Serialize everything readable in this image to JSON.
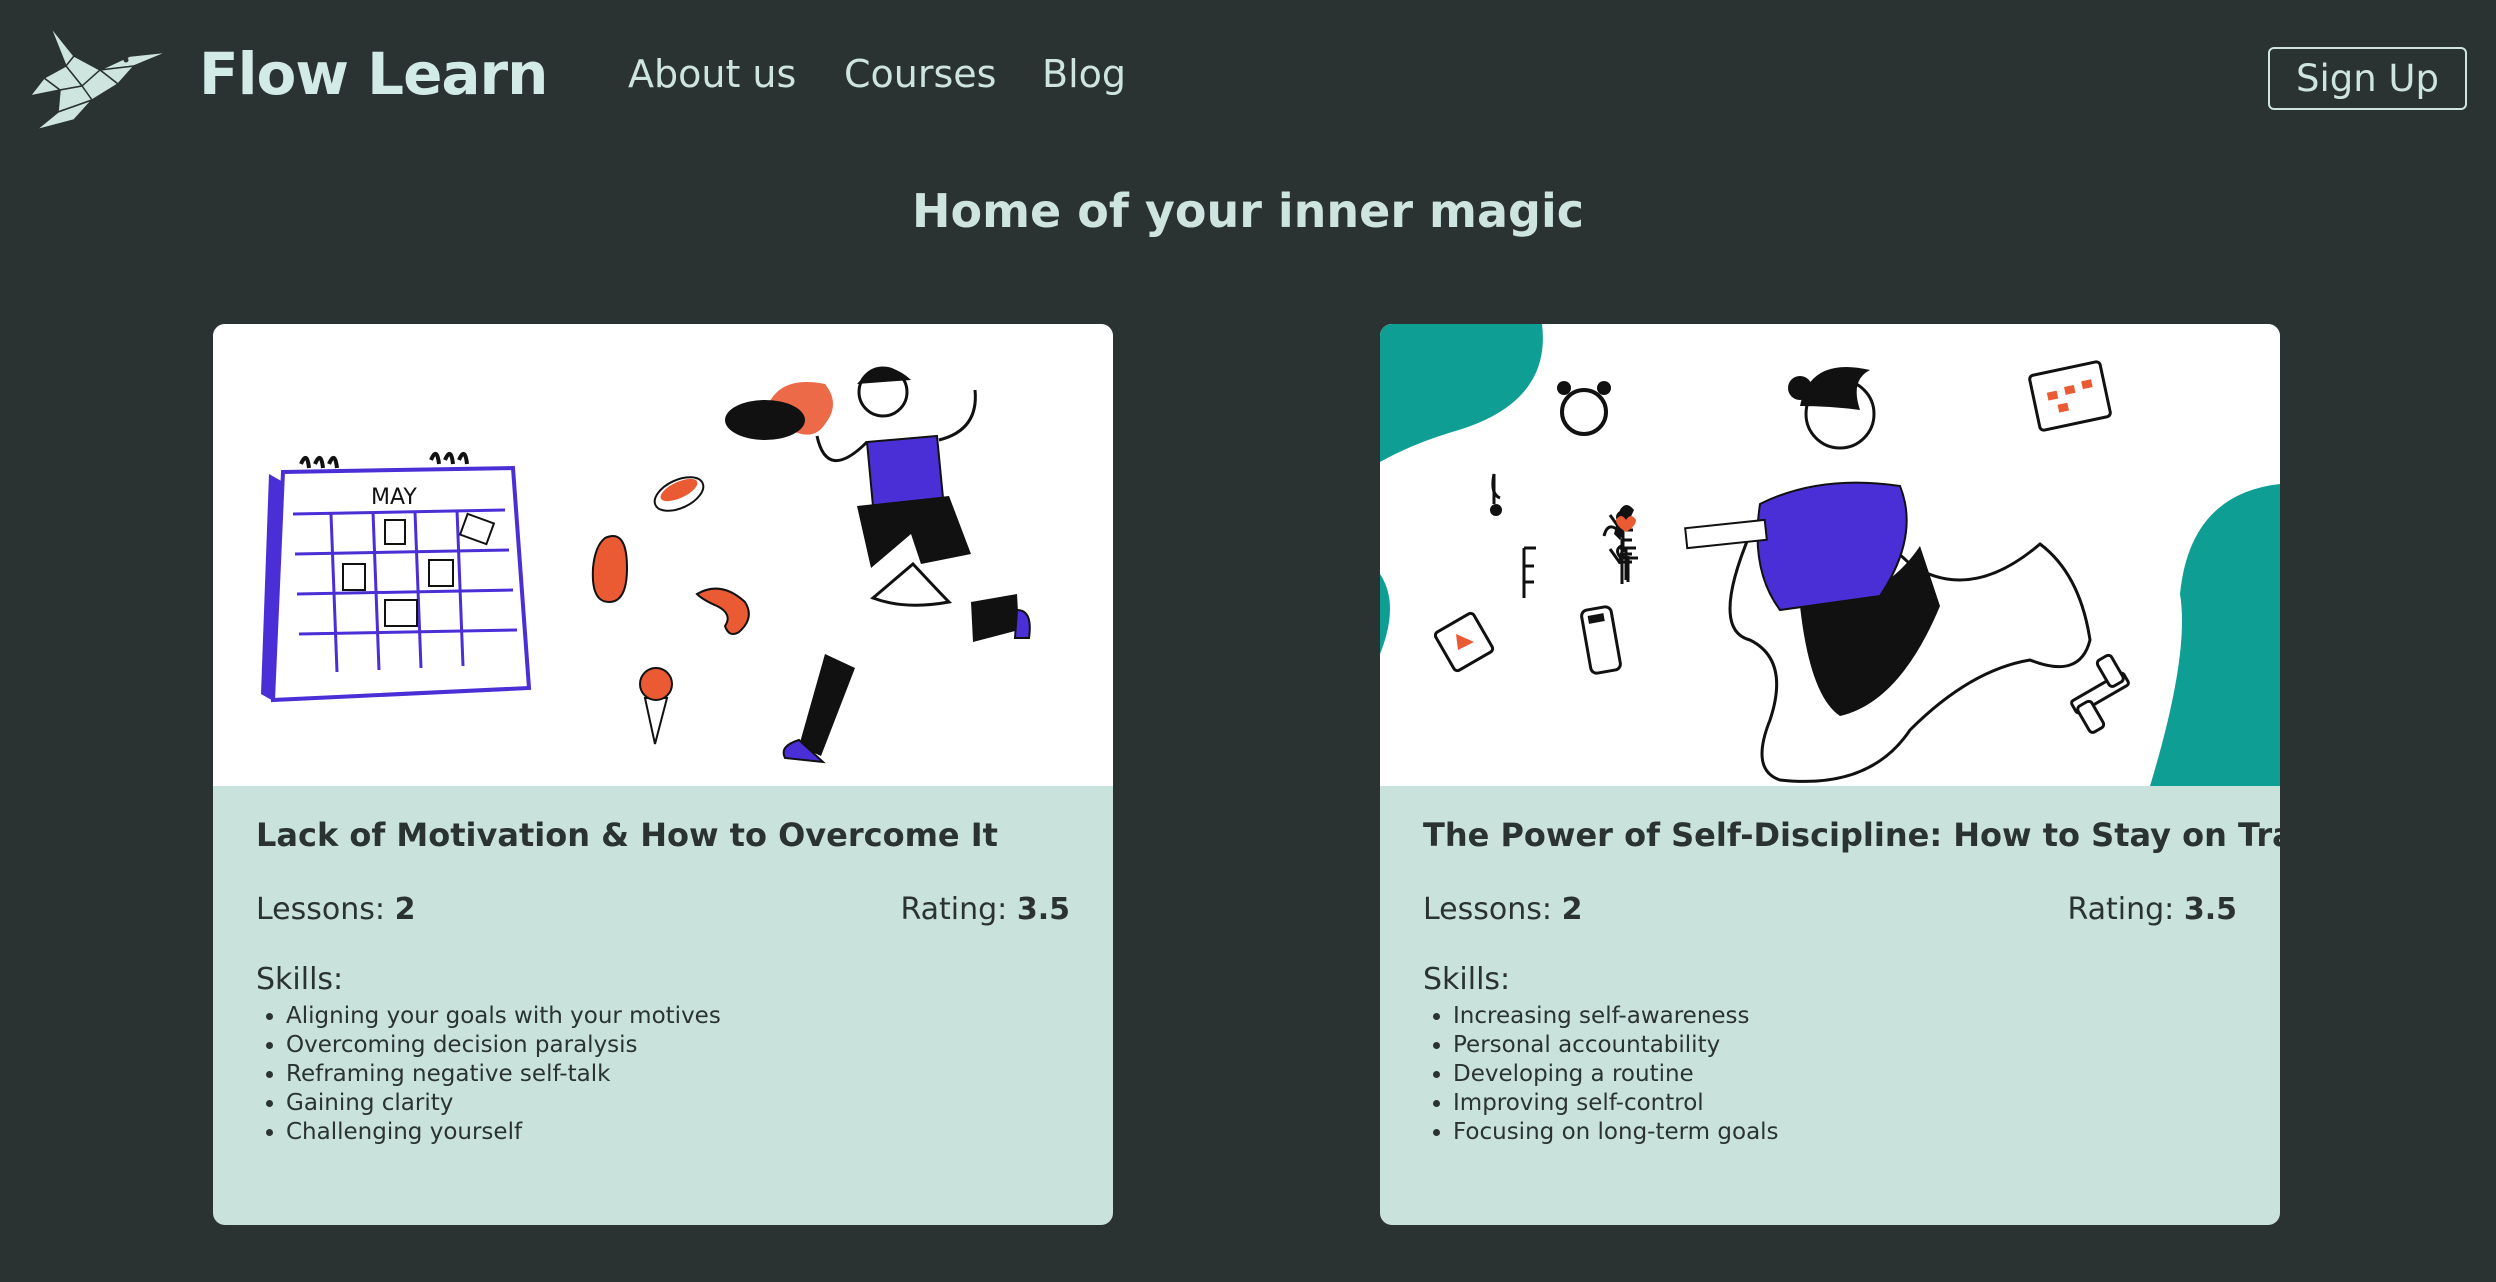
{
  "header": {
    "brand": "Flow Learn",
    "nav": [
      "About us",
      "Courses",
      "Blog"
    ],
    "signup_label": "Sign Up"
  },
  "main": {
    "headline": "Home of your inner magic"
  },
  "courses": [
    {
      "title": "Lack of Motivation & How to Overcome It",
      "lessons_label": "Lessons:",
      "lessons": "2",
      "rating_label": "Rating:",
      "rating": "3.5",
      "skills_label": "Skills:",
      "skills": [
        "Aligning your goals with your motives",
        "Overcoming decision paralysis",
        "Reframing negative self-talk",
        "Gaining clarity",
        "Challenging yourself"
      ],
      "illustration_text": "MAY"
    },
    {
      "title": "The Power of Self-Discipline: How to Stay on Track",
      "lessons_label": "Lessons:",
      "lessons": "2",
      "rating_label": "Rating:",
      "rating": "3.5",
      "skills_label": "Skills:",
      "skills": [
        "Increasing self-awareness",
        "Personal accountability",
        "Developing a routine",
        "Improving self-control",
        "Focusing on long-term goals"
      ]
    }
  ],
  "colors": {
    "background": "#2b3332",
    "text_light": "#cde4df",
    "card_bg": "#c9e2dc",
    "card_text": "#2b3332",
    "accent_purple": "#4b2fd6",
    "accent_teal": "#0e9e94",
    "accent_orange": "#ea5a33"
  },
  "icons": [
    "hummingbird-logo-icon"
  ]
}
